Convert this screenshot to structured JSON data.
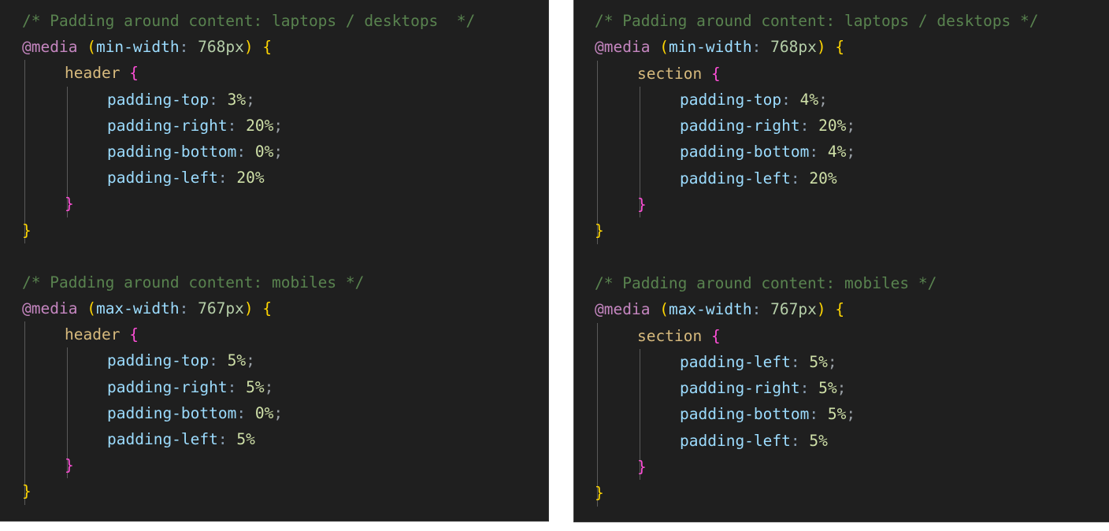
{
  "theme": {
    "page_background": "#ffffff",
    "editor_background": "#1f1f1f",
    "panel_border": "#3a3a3a",
    "indent_guide": "#5a5a5a",
    "comment": "#59834f",
    "at_rule": "#c586c0",
    "paren": "#ffd602",
    "media_feature": "#9cdcfe",
    "number": "#b5cea8",
    "selector": "#d7ba7d",
    "property": "#9cdcfe",
    "value": "#cfe0a8",
    "brace_outer": "#ffd602",
    "brace_inner": "#ff4fd8",
    "semicolon": "#9aa0a6",
    "punctuation": "#8a9fb3"
  },
  "panels": [
    {
      "id": "panel-left",
      "name": "header-padding-code-panel",
      "lines": [
        {
          "indent": 0,
          "guides": 0,
          "tokens": [
            {
              "c": "t-comment",
              "t": "/* Padding around content: laptops / desktops  */"
            }
          ]
        },
        {
          "indent": 0,
          "guides": 0,
          "tokens": [
            {
              "c": "t-atrule",
              "t": "@media"
            },
            {
              "c": "t-plain",
              "t": " "
            },
            {
              "c": "t-paren",
              "t": "("
            },
            {
              "c": "t-feature",
              "t": "min-width"
            },
            {
              "c": "t-punct",
              "t": ":"
            },
            {
              "c": "t-plain",
              "t": " "
            },
            {
              "c": "t-number",
              "t": "768px"
            },
            {
              "c": "t-paren",
              "t": ")"
            },
            {
              "c": "t-plain",
              "t": " "
            },
            {
              "c": "t-brace-y",
              "t": "{"
            }
          ]
        },
        {
          "indent": 1,
          "guides": 1,
          "tokens": [
            {
              "c": "t-selector",
              "t": "header"
            },
            {
              "c": "t-plain",
              "t": " "
            },
            {
              "c": "t-brace-p",
              "t": "{"
            }
          ]
        },
        {
          "indent": 2,
          "guides": 2,
          "tokens": [
            {
              "c": "t-prop",
              "t": "padding-top"
            },
            {
              "c": "t-punct",
              "t": ":"
            },
            {
              "c": "t-plain",
              "t": " "
            },
            {
              "c": "t-value",
              "t": "3%"
            },
            {
              "c": "t-semi",
              "t": ";"
            }
          ]
        },
        {
          "indent": 2,
          "guides": 2,
          "tokens": [
            {
              "c": "t-prop",
              "t": "padding-right"
            },
            {
              "c": "t-punct",
              "t": ":"
            },
            {
              "c": "t-plain",
              "t": " "
            },
            {
              "c": "t-value",
              "t": "20%"
            },
            {
              "c": "t-semi",
              "t": ";"
            }
          ]
        },
        {
          "indent": 2,
          "guides": 2,
          "tokens": [
            {
              "c": "t-prop",
              "t": "padding-bottom"
            },
            {
              "c": "t-punct",
              "t": ":"
            },
            {
              "c": "t-plain",
              "t": " "
            },
            {
              "c": "t-value",
              "t": "0%"
            },
            {
              "c": "t-semi",
              "t": ";"
            }
          ]
        },
        {
          "indent": 2,
          "guides": 2,
          "tokens": [
            {
              "c": "t-prop",
              "t": "padding-left"
            },
            {
              "c": "t-punct",
              "t": ":"
            },
            {
              "c": "t-plain",
              "t": " "
            },
            {
              "c": "t-value",
              "t": "20%"
            }
          ]
        },
        {
          "indent": 1,
          "guides": 2,
          "tokens": [
            {
              "c": "t-brace-p",
              "t": "}"
            }
          ]
        },
        {
          "indent": 0,
          "guides": 1,
          "tokens": [
            {
              "c": "t-brace-y",
              "t": "}"
            }
          ]
        },
        {
          "indent": 0,
          "guides": 0,
          "tokens": [
            {
              "c": "t-plain",
              "t": ""
            }
          ]
        },
        {
          "indent": 0,
          "guides": 0,
          "tokens": [
            {
              "c": "t-comment",
              "t": "/* Padding around content: mobiles */"
            }
          ]
        },
        {
          "indent": 0,
          "guides": 0,
          "tokens": [
            {
              "c": "t-atrule",
              "t": "@media"
            },
            {
              "c": "t-plain",
              "t": " "
            },
            {
              "c": "t-paren",
              "t": "("
            },
            {
              "c": "t-feature",
              "t": "max-width"
            },
            {
              "c": "t-punct",
              "t": ":"
            },
            {
              "c": "t-plain",
              "t": " "
            },
            {
              "c": "t-number",
              "t": "767px"
            },
            {
              "c": "t-paren",
              "t": ")"
            },
            {
              "c": "t-plain",
              "t": " "
            },
            {
              "c": "t-brace-y",
              "t": "{"
            }
          ]
        },
        {
          "indent": 1,
          "guides": 1,
          "tokens": [
            {
              "c": "t-selector",
              "t": "header"
            },
            {
              "c": "t-plain",
              "t": " "
            },
            {
              "c": "t-brace-p",
              "t": "{"
            }
          ]
        },
        {
          "indent": 2,
          "guides": 2,
          "tokens": [
            {
              "c": "t-prop",
              "t": "padding-top"
            },
            {
              "c": "t-punct",
              "t": ":"
            },
            {
              "c": "t-plain",
              "t": " "
            },
            {
              "c": "t-value",
              "t": "5%"
            },
            {
              "c": "t-semi",
              "t": ";"
            }
          ]
        },
        {
          "indent": 2,
          "guides": 2,
          "tokens": [
            {
              "c": "t-prop",
              "t": "padding-right"
            },
            {
              "c": "t-punct",
              "t": ":"
            },
            {
              "c": "t-plain",
              "t": " "
            },
            {
              "c": "t-value",
              "t": "5%"
            },
            {
              "c": "t-semi",
              "t": ";"
            }
          ]
        },
        {
          "indent": 2,
          "guides": 2,
          "tokens": [
            {
              "c": "t-prop",
              "t": "padding-bottom"
            },
            {
              "c": "t-punct",
              "t": ":"
            },
            {
              "c": "t-plain",
              "t": " "
            },
            {
              "c": "t-value",
              "t": "0%"
            },
            {
              "c": "t-semi",
              "t": ";"
            }
          ]
        },
        {
          "indent": 2,
          "guides": 2,
          "tokens": [
            {
              "c": "t-prop",
              "t": "padding-left"
            },
            {
              "c": "t-punct",
              "t": ":"
            },
            {
              "c": "t-plain",
              "t": " "
            },
            {
              "c": "t-value",
              "t": "5%"
            }
          ]
        },
        {
          "indent": 1,
          "guides": 2,
          "tokens": [
            {
              "c": "t-brace-p",
              "t": "}"
            }
          ]
        },
        {
          "indent": 0,
          "guides": 1,
          "tokens": [
            {
              "c": "t-brace-y",
              "t": "}"
            }
          ]
        }
      ]
    },
    {
      "id": "panel-right",
      "name": "section-padding-code-panel",
      "lines": [
        {
          "indent": 0,
          "guides": 0,
          "tokens": [
            {
              "c": "t-comment",
              "t": "/* Padding around content: laptops / desktops */"
            }
          ]
        },
        {
          "indent": 0,
          "guides": 0,
          "tokens": [
            {
              "c": "t-atrule",
              "t": "@media"
            },
            {
              "c": "t-plain",
              "t": " "
            },
            {
              "c": "t-paren",
              "t": "("
            },
            {
              "c": "t-feature",
              "t": "min-width"
            },
            {
              "c": "t-punct",
              "t": ":"
            },
            {
              "c": "t-plain",
              "t": " "
            },
            {
              "c": "t-number",
              "t": "768px"
            },
            {
              "c": "t-paren",
              "t": ")"
            },
            {
              "c": "t-plain",
              "t": " "
            },
            {
              "c": "t-brace-y",
              "t": "{"
            }
          ]
        },
        {
          "indent": 1,
          "guides": 1,
          "tokens": [
            {
              "c": "t-selector",
              "t": "section"
            },
            {
              "c": "t-plain",
              "t": " "
            },
            {
              "c": "t-brace-p",
              "t": "{"
            }
          ]
        },
        {
          "indent": 2,
          "guides": 2,
          "tokens": [
            {
              "c": "t-prop",
              "t": "padding-top"
            },
            {
              "c": "t-punct",
              "t": ":"
            },
            {
              "c": "t-plain",
              "t": " "
            },
            {
              "c": "t-value",
              "t": "4%"
            },
            {
              "c": "t-semi",
              "t": ";"
            }
          ]
        },
        {
          "indent": 2,
          "guides": 2,
          "tokens": [
            {
              "c": "t-prop",
              "t": "padding-right"
            },
            {
              "c": "t-punct",
              "t": ":"
            },
            {
              "c": "t-plain",
              "t": " "
            },
            {
              "c": "t-value",
              "t": "20%"
            },
            {
              "c": "t-semi",
              "t": ";"
            }
          ]
        },
        {
          "indent": 2,
          "guides": 2,
          "tokens": [
            {
              "c": "t-prop",
              "t": "padding-bottom"
            },
            {
              "c": "t-punct",
              "t": ":"
            },
            {
              "c": "t-plain",
              "t": " "
            },
            {
              "c": "t-value",
              "t": "4%"
            },
            {
              "c": "t-semi",
              "t": ";"
            }
          ]
        },
        {
          "indent": 2,
          "guides": 2,
          "tokens": [
            {
              "c": "t-prop",
              "t": "padding-left"
            },
            {
              "c": "t-punct",
              "t": ":"
            },
            {
              "c": "t-plain",
              "t": " "
            },
            {
              "c": "t-value",
              "t": "20%"
            }
          ]
        },
        {
          "indent": 1,
          "guides": 2,
          "tokens": [
            {
              "c": "t-brace-p",
              "t": "}"
            }
          ]
        },
        {
          "indent": 0,
          "guides": 1,
          "tokens": [
            {
              "c": "t-brace-y",
              "t": "}"
            }
          ]
        },
        {
          "indent": 0,
          "guides": 0,
          "tokens": [
            {
              "c": "t-plain",
              "t": ""
            }
          ]
        },
        {
          "indent": 0,
          "guides": 0,
          "tokens": [
            {
              "c": "t-comment",
              "t": "/* Padding around content: mobiles */"
            }
          ]
        },
        {
          "indent": 0,
          "guides": 0,
          "tokens": [
            {
              "c": "t-atrule",
              "t": "@media"
            },
            {
              "c": "t-plain",
              "t": " "
            },
            {
              "c": "t-paren",
              "t": "("
            },
            {
              "c": "t-feature",
              "t": "max-width"
            },
            {
              "c": "t-punct",
              "t": ":"
            },
            {
              "c": "t-plain",
              "t": " "
            },
            {
              "c": "t-number",
              "t": "767px"
            },
            {
              "c": "t-paren",
              "t": ")"
            },
            {
              "c": "t-plain",
              "t": " "
            },
            {
              "c": "t-brace-y",
              "t": "{"
            }
          ]
        },
        {
          "indent": 1,
          "guides": 1,
          "tokens": [
            {
              "c": "t-selector",
              "t": "section"
            },
            {
              "c": "t-plain",
              "t": " "
            },
            {
              "c": "t-brace-p",
              "t": "{"
            }
          ]
        },
        {
          "indent": 2,
          "guides": 2,
          "tokens": [
            {
              "c": "t-prop",
              "t": "padding-left"
            },
            {
              "c": "t-punct",
              "t": ":"
            },
            {
              "c": "t-plain",
              "t": " "
            },
            {
              "c": "t-value",
              "t": "5%"
            },
            {
              "c": "t-semi",
              "t": ";"
            }
          ]
        },
        {
          "indent": 2,
          "guides": 2,
          "tokens": [
            {
              "c": "t-prop",
              "t": "padding-right"
            },
            {
              "c": "t-punct",
              "t": ":"
            },
            {
              "c": "t-plain",
              "t": " "
            },
            {
              "c": "t-value",
              "t": "5%"
            },
            {
              "c": "t-semi",
              "t": ";"
            }
          ]
        },
        {
          "indent": 2,
          "guides": 2,
          "tokens": [
            {
              "c": "t-prop",
              "t": "padding-bottom"
            },
            {
              "c": "t-punct",
              "t": ":"
            },
            {
              "c": "t-plain",
              "t": " "
            },
            {
              "c": "t-value",
              "t": "5%"
            },
            {
              "c": "t-semi",
              "t": ";"
            }
          ]
        },
        {
          "indent": 2,
          "guides": 2,
          "tokens": [
            {
              "c": "t-prop",
              "t": "padding-left"
            },
            {
              "c": "t-punct",
              "t": ":"
            },
            {
              "c": "t-plain",
              "t": " "
            },
            {
              "c": "t-value",
              "t": "5%"
            }
          ]
        },
        {
          "indent": 1,
          "guides": 2,
          "tokens": [
            {
              "c": "t-brace-p",
              "t": "}"
            }
          ]
        },
        {
          "indent": 0,
          "guides": 1,
          "tokens": [
            {
              "c": "t-brace-y",
              "t": "}"
            }
          ]
        }
      ]
    }
  ]
}
